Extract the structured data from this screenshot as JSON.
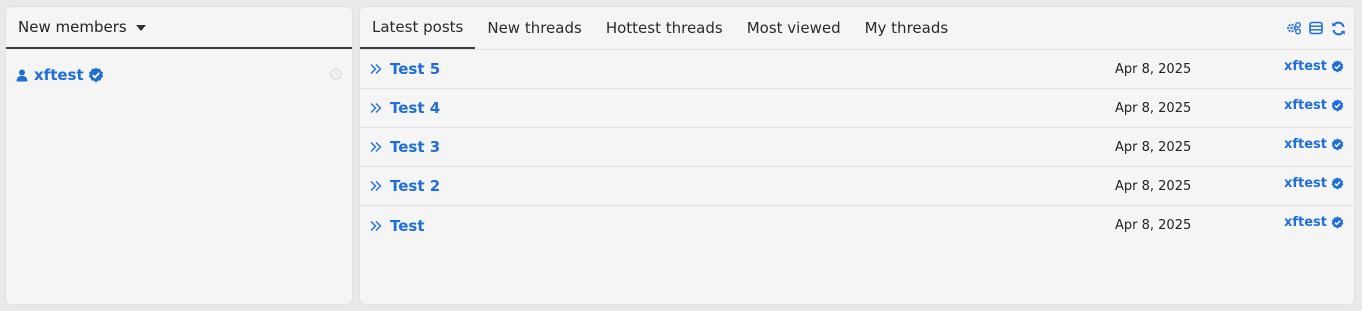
{
  "left": {
    "header_label": "New members",
    "members": [
      {
        "name": "xftest"
      }
    ]
  },
  "tabs": [
    {
      "label": "Latest posts",
      "active": true
    },
    {
      "label": "New threads"
    },
    {
      "label": "Hottest threads"
    },
    {
      "label": "Most viewed"
    },
    {
      "label": "My threads"
    }
  ],
  "threads": [
    {
      "title": "Test 5",
      "date": "Apr 8, 2025",
      "user": "xftest"
    },
    {
      "title": "Test 4",
      "date": "Apr 8, 2025",
      "user": "xftest"
    },
    {
      "title": "Test 3",
      "date": "Apr 8, 2025",
      "user": "xftest"
    },
    {
      "title": "Test 2",
      "date": "Apr 8, 2025",
      "user": "xftest"
    },
    {
      "title": "Test",
      "date": "Apr 8, 2025",
      "user": "xftest"
    }
  ],
  "colors": {
    "link": "#1e6fd9",
    "accent_border": "#3a3a44"
  },
  "icons": [
    "user-icon",
    "verified-badge-icon",
    "clock-icon",
    "settings-icon",
    "layout-icon",
    "refresh-icon",
    "double-chevron-right-icon"
  ]
}
